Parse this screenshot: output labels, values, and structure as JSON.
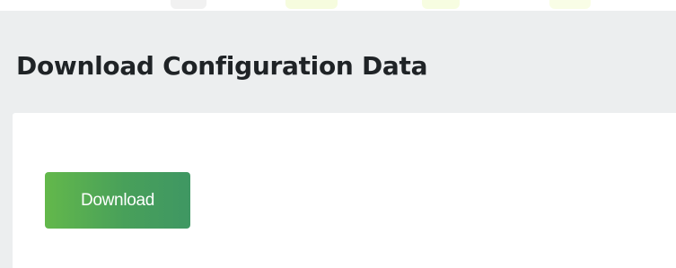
{
  "section": {
    "title": "Download Configuration Data"
  },
  "actions": {
    "download_label": "Download"
  },
  "colors": {
    "panel_background": "#eceeef",
    "card_background": "#ffffff",
    "button_gradient_start": "#63b84b",
    "button_gradient_end": "#3f9763",
    "button_text": "#ffffff",
    "title_text": "#1f2326"
  }
}
